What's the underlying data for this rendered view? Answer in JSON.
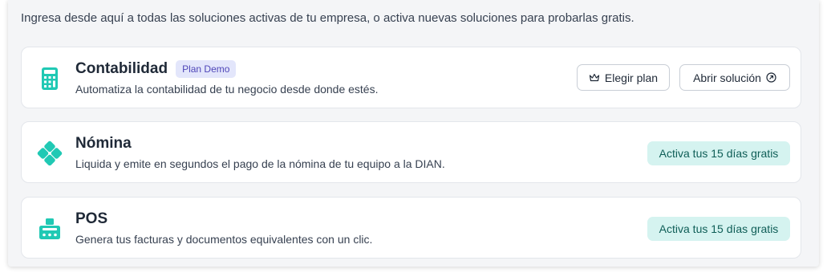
{
  "intro_text": "Ingresa desde aquí a todas las soluciones activas de tu empresa, o activa nuevas soluciones para probarlas gratis.",
  "accent_color": "#20c9b4",
  "solutions": [
    {
      "title": "Contabilidad",
      "badge": "Plan Demo",
      "description": "Automatiza la contabilidad de tu negocio desde donde estés.",
      "icon": "calculator-icon",
      "choose_plan_label": "Elegir plan",
      "open_label": "Abrir solución"
    },
    {
      "title": "Nómina",
      "description": "Liquida y emite en segundos el pago de la nómina de tu equipo a la DIAN.",
      "icon": "payroll-diamond-icon",
      "trial_label": "Activa tus 15 días gratis"
    },
    {
      "title": "POS",
      "description": "Genera tus facturas y documentos equivalentes con un clic.",
      "icon": "pos-register-icon",
      "trial_label": "Activa tus 15 días gratis"
    }
  ]
}
